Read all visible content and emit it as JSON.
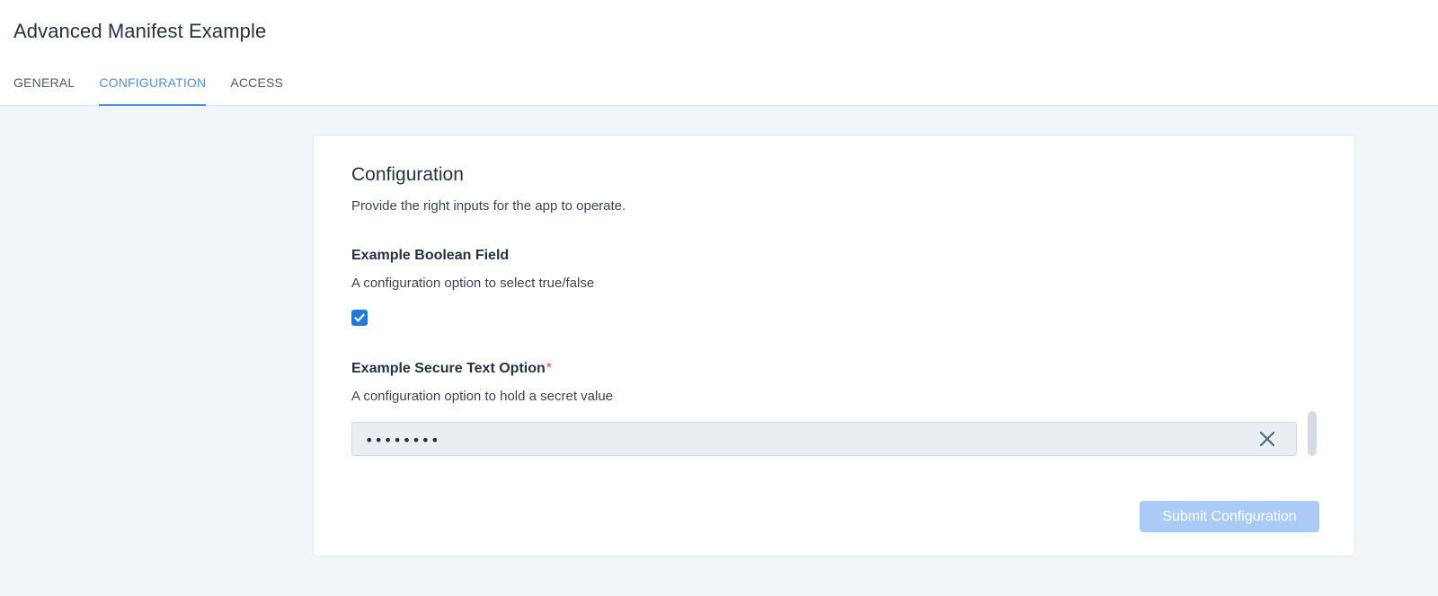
{
  "app": {
    "title": "Advanced Manifest Example"
  },
  "tabs": [
    {
      "label": "GENERAL",
      "active": false
    },
    {
      "label": "CONFIGURATION",
      "active": true
    },
    {
      "label": "ACCESS",
      "active": false
    }
  ],
  "configuration": {
    "title": "Configuration",
    "subtitle": "Provide the right inputs for the app to operate.",
    "boolean_field": {
      "label": "Example Boolean Field",
      "description": "A configuration option to select true/false",
      "checked": true
    },
    "secure_field": {
      "label": "Example Secure Text Option",
      "required_marker": "*",
      "description": "A configuration option to hold a secret value",
      "masked_value": "••••••••",
      "clear_icon": "close-icon"
    },
    "submit_label": "Submit Configuration"
  },
  "colors": {
    "accent": "#4d8ee8",
    "checkbox": "#1f7ae0",
    "submit_disabled": "#a9cbf6",
    "required": "#e0463b"
  }
}
